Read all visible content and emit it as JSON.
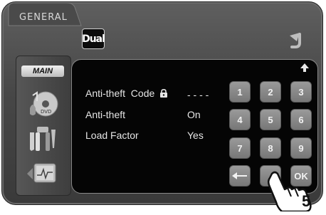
{
  "header": {
    "section_title": "GENERAL",
    "logo_text": "Dual"
  },
  "sidebar": {
    "main_label": "MAIN"
  },
  "settings": [
    {
      "label": "Anti-theft  Code",
      "value": "- - - -"
    },
    {
      "label": "Anti-theft",
      "value": "On"
    },
    {
      "label": "Load Factor",
      "value": "Yes"
    }
  ],
  "keypad": {
    "keys": [
      "1",
      "2",
      "3",
      "4",
      "5",
      "6",
      "7",
      "8",
      "9"
    ],
    "zero_label": "",
    "ok_label": "OK"
  },
  "overlay": {
    "step_number": "5"
  },
  "icons": {
    "back": "back-arrow-icon",
    "scroll_up": "scroll-up-icon",
    "lock": "lock-icon",
    "backspace": "backspace-icon"
  }
}
